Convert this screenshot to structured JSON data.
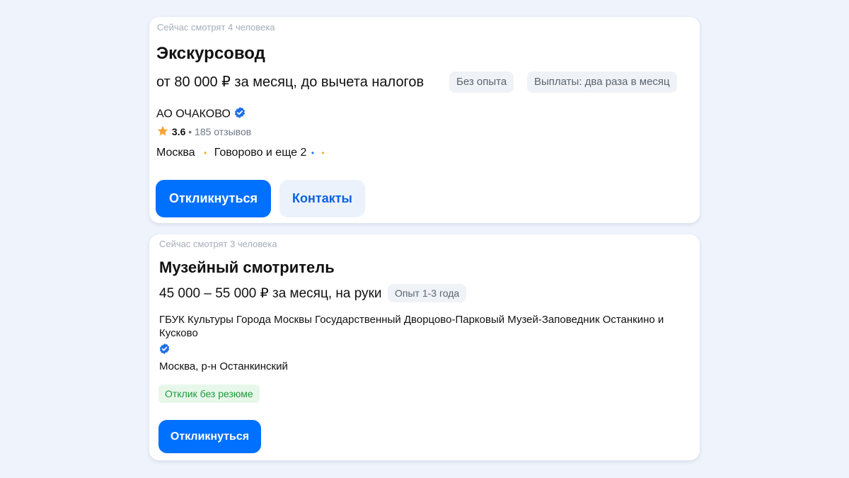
{
  "vacancies": [
    {
      "viewers": "Сейчас смотрят 4 человека",
      "title": "Экскурсовод",
      "salary": "от 80 000 ₽ за месяц, до вычета налогов",
      "tags": [
        "Без опыта",
        "Выплаты: два раза в месяц"
      ],
      "company": "АО ОЧАКОВО",
      "rating": "3.6",
      "reviews": "185 отзывов",
      "city": "Москва",
      "metro": "Говорово и еще 2",
      "apply_label": "Откликнуться",
      "contacts_label": "Контакты"
    },
    {
      "viewers": "Сейчас смотрят 3 человека",
      "title": "Музейный смотритель",
      "salary": "45 000 – 55 000 ₽ за месяц, на руки",
      "tags": [
        "Опыт 1-3 года"
      ],
      "company_line1": "ГБУК Культуры Города Москвы Государственный Дворцово-Парковый Музей-Заповедник Останкино и",
      "company_line2": "Кусково",
      "address": "Москва, р-н Останкинский",
      "badge": "Отклик без резюме",
      "apply_label": "Откликнуться"
    }
  ],
  "colors": {
    "background": "#eef3fc",
    "primary": "#0070ff",
    "verified": "#1f6fe5",
    "rating_star": "#f6a33b",
    "metro_yellow": "#f3b11b",
    "metro_blue": "#1e73ff",
    "badge_green": "#1f9a3b"
  },
  "icons": [
    "verified-icon",
    "star-icon"
  ]
}
